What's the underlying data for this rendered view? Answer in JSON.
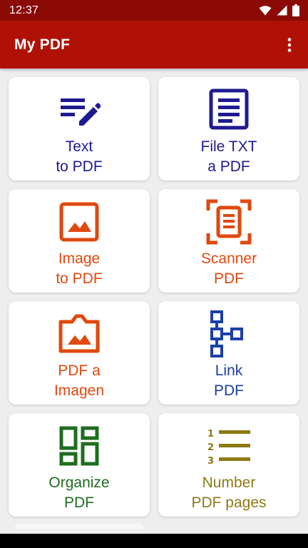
{
  "status_bar": {
    "time": "12:37",
    "icons": [
      "wifi-icon",
      "signal-icon",
      "battery-icon"
    ]
  },
  "app_bar": {
    "title": "My PDF",
    "menu_icon": "more-vert-icon",
    "color": "#b01107"
  },
  "cards": [
    {
      "id": "text-to-pdf",
      "icon": "notes-edit-icon",
      "line1": "Text",
      "line2": "to PDF",
      "color": "#1f1a8f"
    },
    {
      "id": "file-txt-a-pdf",
      "icon": "document-icon",
      "line1": "File TXT",
      "line2": "a PDF",
      "color": "#1f1a8f"
    },
    {
      "id": "image-to-pdf",
      "icon": "image-icon",
      "line1": "Image",
      "line2": "to PDF",
      "color": "#e0480f"
    },
    {
      "id": "scanner-pdf",
      "icon": "scanner-icon",
      "line1": "Scanner",
      "line2": "PDF",
      "color": "#e0480f"
    },
    {
      "id": "pdf-a-imagen",
      "icon": "photo-folder-icon",
      "line1": "PDF a",
      "line2": "Imagen",
      "color": "#e0480f"
    },
    {
      "id": "link-pdf",
      "icon": "link-tree-icon",
      "line1": "Link",
      "line2": "PDF",
      "color": "#1a3fa8"
    },
    {
      "id": "organize-pdf",
      "icon": "dashboard-icon",
      "line1": "Organize",
      "line2": "PDF",
      "color": "#1f6d1f"
    },
    {
      "id": "number-pdf-pages",
      "icon": "numbered-list-icon",
      "line1": "Number",
      "line2": "PDF pages",
      "color": "#8c7a16"
    }
  ]
}
